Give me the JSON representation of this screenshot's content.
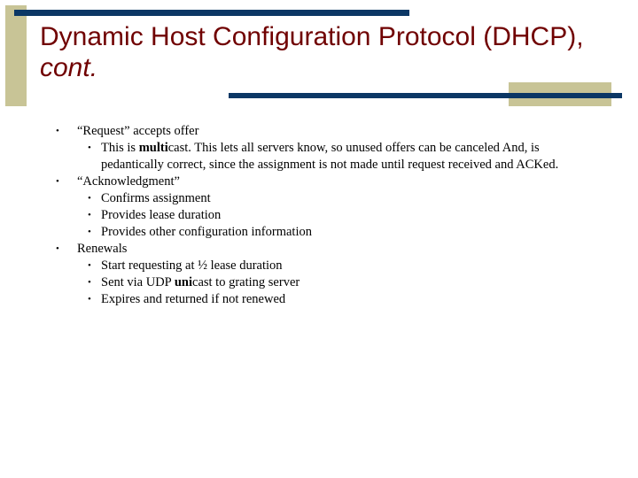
{
  "slide": {
    "title_main": "Dynamic Host Configuration Protocol (DHCP),",
    "title_italic": "cont.",
    "bullet_glyph": "•",
    "items": [
      {
        "text": "“Request” accepts offer",
        "children": [
          {
            "pre": "This is ",
            "bold": "multi",
            "post": "cast. This lets all servers know, so unused offers can be canceled And, is pedantically correct, since the assignment is not made until request received and ACKed."
          }
        ]
      },
      {
        "text": "“Acknowledgment”",
        "children": [
          {
            "pre": "Confirms assignment",
            "bold": "",
            "post": ""
          },
          {
            "pre": "Provides lease duration",
            "bold": "",
            "post": ""
          },
          {
            "pre": "Provides other configuration information",
            "bold": "",
            "post": ""
          }
        ]
      },
      {
        "text": "Renewals",
        "children": [
          {
            "pre": "Start requesting at ½ lease duration",
            "bold": "",
            "post": ""
          },
          {
            "pre": "Sent via UDP ",
            "bold": "uni",
            "post": "cast to grating server"
          },
          {
            "pre": "Expires and returned if not renewed",
            "bold": "",
            "post": ""
          }
        ]
      }
    ]
  },
  "colors": {
    "title": "#700000",
    "navy_bar": "#0b3765",
    "tan_accent": "#c8c496"
  }
}
